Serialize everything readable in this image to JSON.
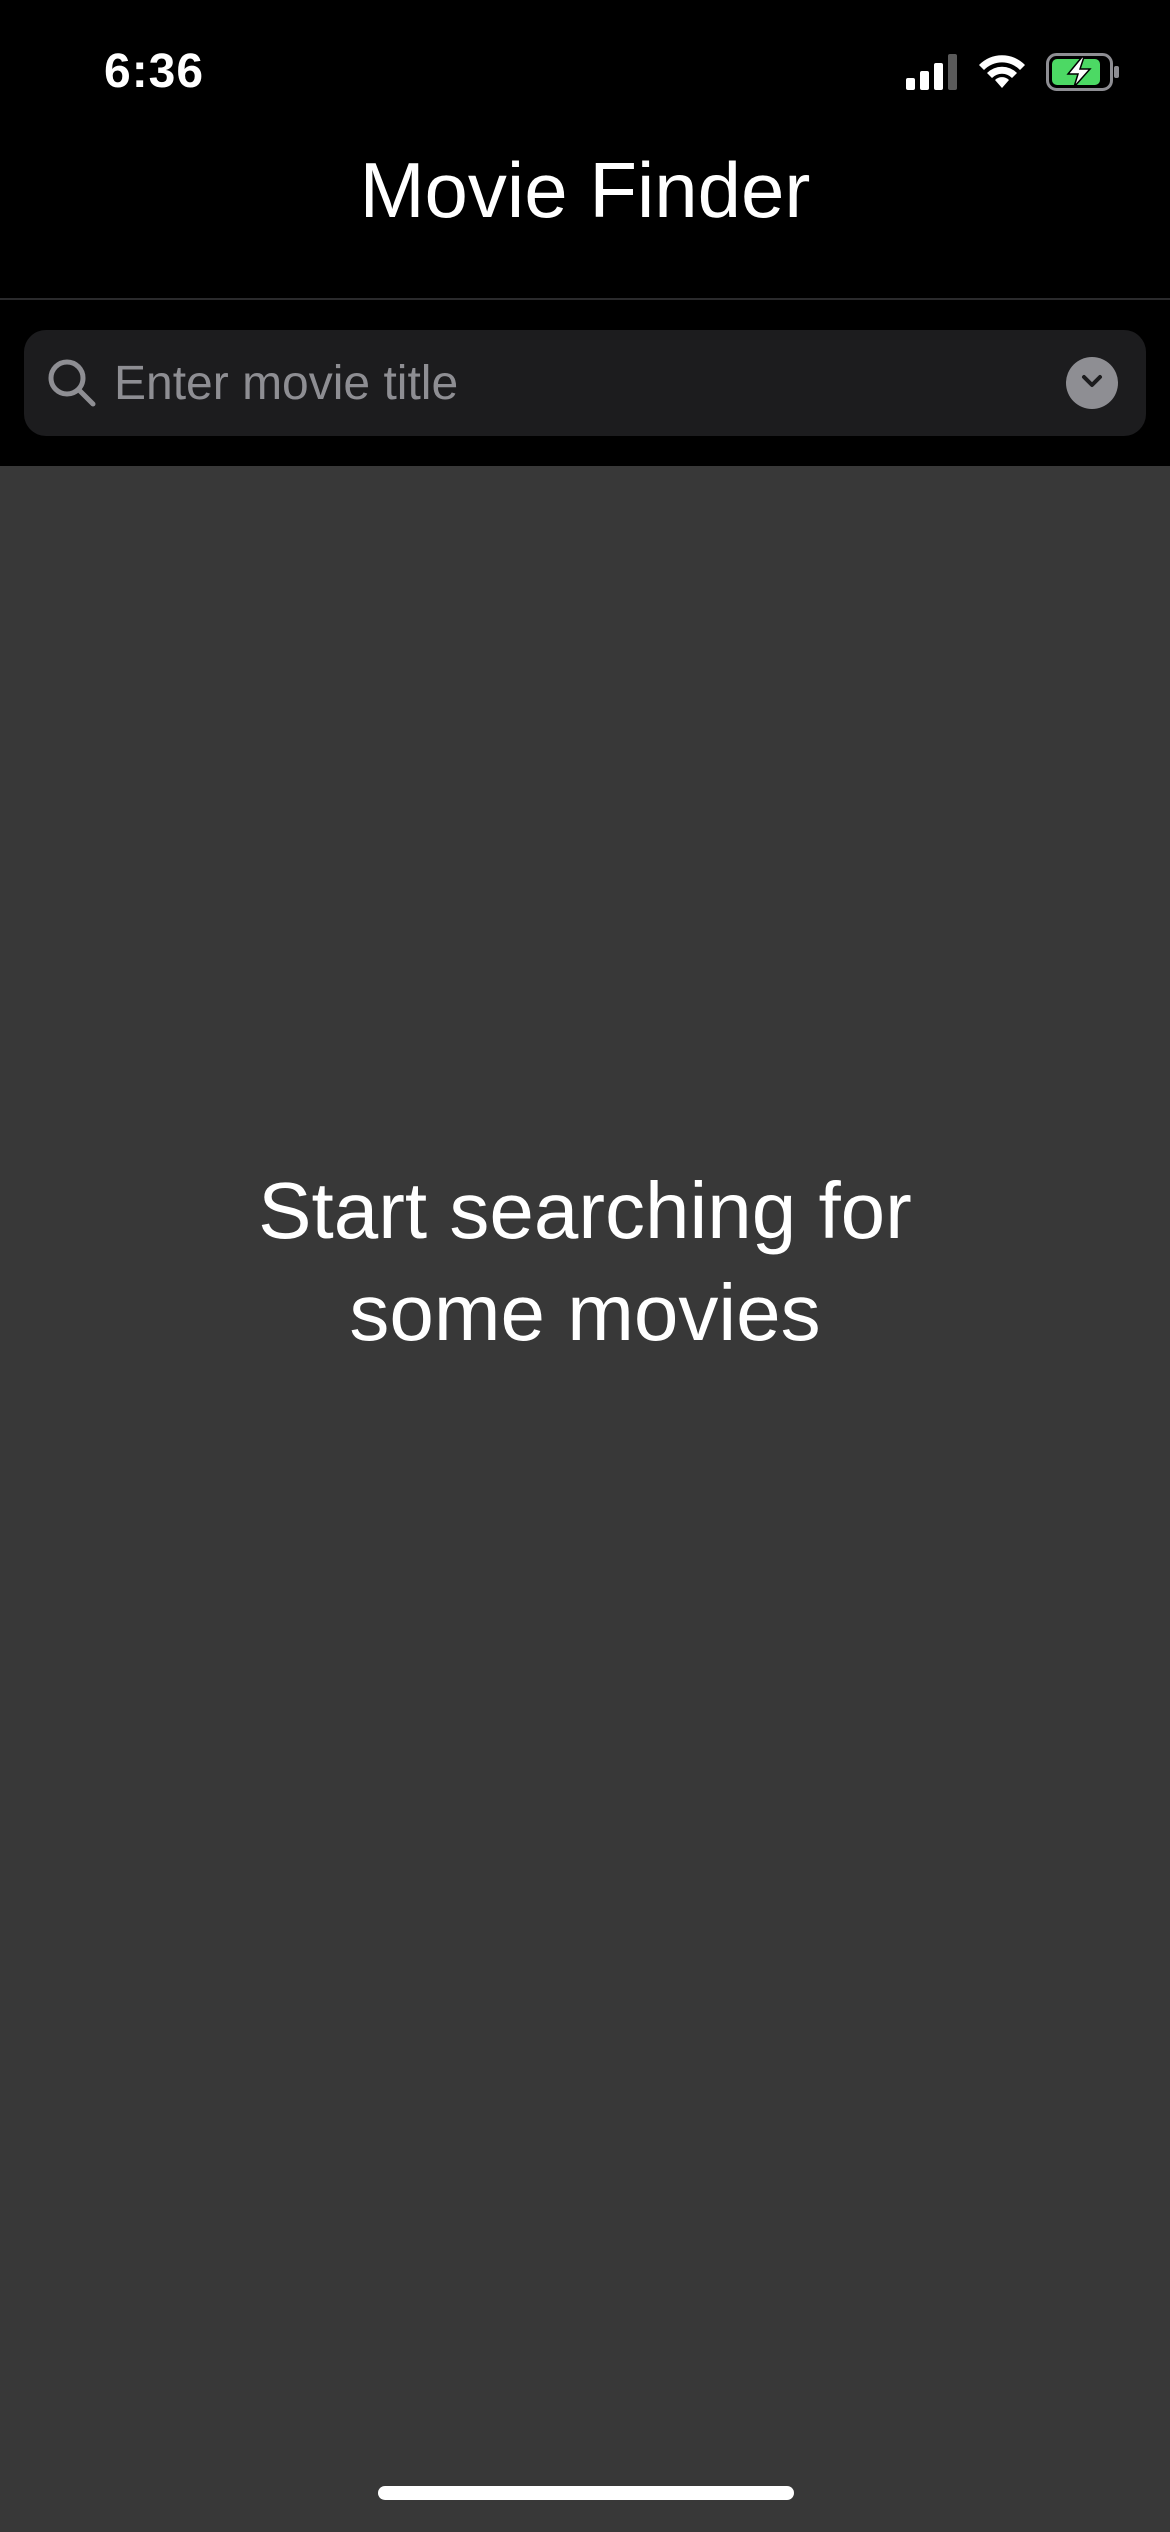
{
  "status_bar": {
    "time": "6:36",
    "icons": [
      "cellular-signal-icon",
      "wifi-icon",
      "battery-charging-icon"
    ],
    "battery_color": "#4cd964"
  },
  "nav": {
    "title": "Movie Finder"
  },
  "search": {
    "placeholder": "Enter movie title",
    "value": "",
    "icon": "search-icon",
    "dropdown_icon": "chevron-down-icon"
  },
  "empty_state": {
    "message": "Start searching for\nsome movies"
  },
  "colors": {
    "background": "#383838",
    "bar_background": "#000000",
    "field_background": "#1c1c1e",
    "placeholder": "#8e8e93"
  }
}
